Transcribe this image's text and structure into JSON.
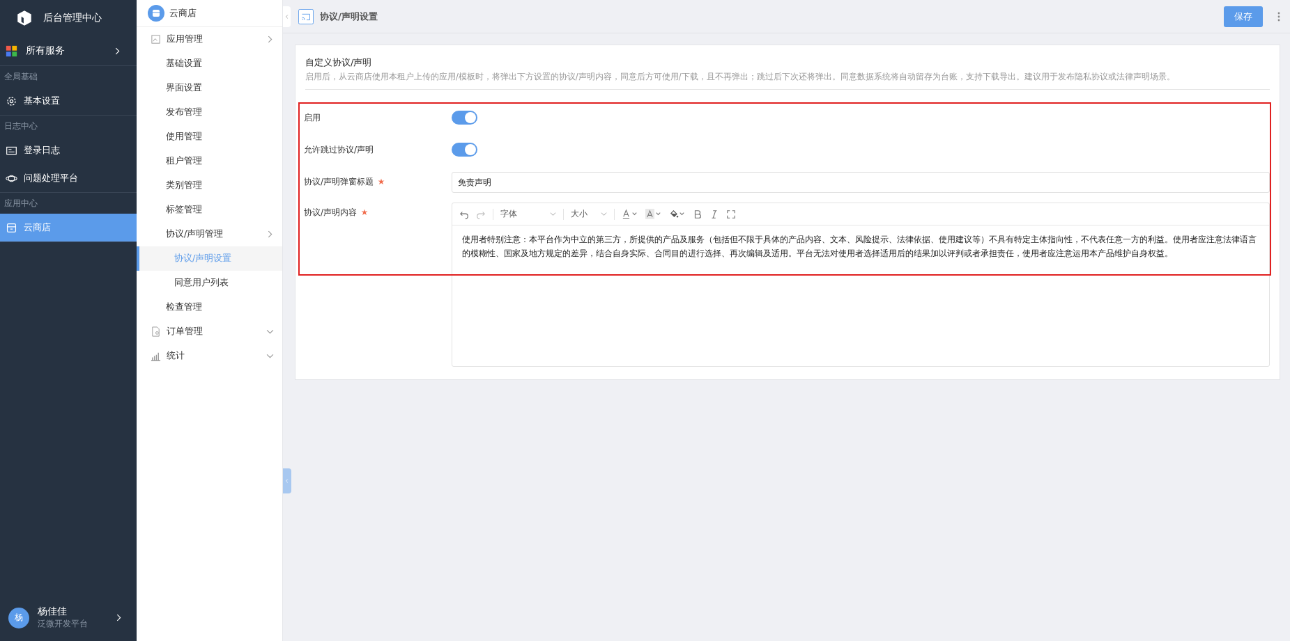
{
  "brand": {
    "title": "后台管理中心"
  },
  "services": {
    "label": "所有服务"
  },
  "nav_sections": [
    {
      "title": "全局基础",
      "items": [
        {
          "label": "基本设置",
          "selected": false
        }
      ]
    },
    {
      "title": "日志中心",
      "items": [
        {
          "label": "登录日志",
          "selected": false
        },
        {
          "label": "问题处理平台",
          "selected": false
        }
      ]
    },
    {
      "title": "应用中心",
      "items": [
        {
          "label": "云商店",
          "selected": true
        }
      ]
    }
  ],
  "user": {
    "avatar": "杨",
    "name": "杨佳佳",
    "org": "泛微开发平台"
  },
  "submenu": {
    "title": "云商店",
    "items": [
      {
        "label": "应用管理",
        "expanded": true,
        "children": [
          {
            "label": "基础设置",
            "selected": false
          },
          {
            "label": "界面设置",
            "selected": false
          },
          {
            "label": "发布管理",
            "selected": false
          },
          {
            "label": "使用管理",
            "selected": false
          },
          {
            "label": "租户管理",
            "selected": false
          },
          {
            "label": "类别管理",
            "selected": false
          },
          {
            "label": "标签管理",
            "selected": false
          },
          {
            "label": "协议/声明管理",
            "expanded": true,
            "children": [
              {
                "label": "协议/声明设置",
                "selected": true
              },
              {
                "label": "同意用户列表",
                "selected": false
              }
            ]
          },
          {
            "label": "检查管理",
            "selected": false
          }
        ]
      },
      {
        "label": "订单管理",
        "expanded": false
      },
      {
        "label": "统计",
        "expanded": false
      }
    ]
  },
  "page": {
    "title": "协议/声明设置",
    "save_button": "保存"
  },
  "section": {
    "title": "自定义协议/声明",
    "description": "启用后，从云商店使用本租户上传的应用/模板时，将弹出下方设置的协议/声明内容，同意后方可使用/下载，且不再弹出；跳过后下次还将弹出。同意数据系统将自动留存为台账，支持下载导出。建议用于发布隐私协议或法律声明场景。"
  },
  "form": [
    {
      "kind": "toggle",
      "label": "启用",
      "on": true
    },
    {
      "kind": "toggle",
      "label": "允许跳过协议/声明",
      "on": true
    },
    {
      "kind": "input",
      "label": "协议/声明弹窗标题",
      "required": true,
      "value": "免责声明"
    },
    {
      "kind": "editor",
      "label": "协议/声明内容",
      "required": true,
      "font": "字体",
      "size": "大小",
      "content": "使用者特别注意：本平台作为中立的第三方，所提供的产品及服务（包括但不限于具体的产品内容、文本、风险提示、法律依据、使用建议等）不具有特定主体指向性，不代表任意一方的利益。使用者应注意法律语言的模糊性、国家及地方规定的差异，结合自身实际、合同目的进行选择、再次编辑及适用。平台无法对使用者选择适用后的结果加以评判或者承担责任，使用者应注意运用本产品维护自身权益。"
    }
  ]
}
